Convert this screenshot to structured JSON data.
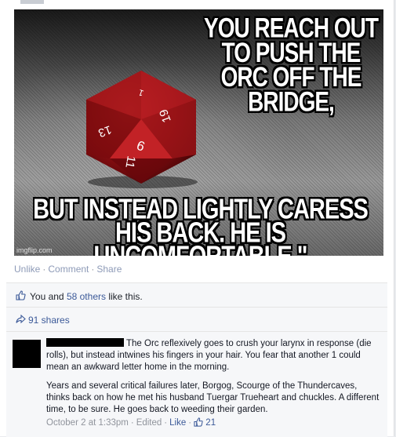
{
  "meme": {
    "top_caption": "You reach out to push the orc off the bridge,",
    "bottom_caption": "But instead lightly caress his back. He is uncomfortable.\"",
    "watermark": "imgflip.com"
  },
  "post_actions": {
    "unlike": "Unlike",
    "comment": "Comment",
    "share": "Share"
  },
  "likes": {
    "prefix": "You and",
    "others": "58 others",
    "suffix": "like this."
  },
  "shares": {
    "label": "91 shares"
  },
  "comment": {
    "line1_text": "The Orc reflexively goes to crush your larynx in response (die rolls), but instead intwines his fingers in your hair. You fear that another 1 could mean an awkward letter home in the morning.",
    "paragraph2": "Years and several critical failures later, Borgog, Scourge of the Thundercaves, thinks back on how he met his husband Tuergar Trueheart and chuckles. A different time, to be sure. He goes back to weeding their garden.",
    "timestamp": "October 2 at 1:33pm",
    "edited": "Edited",
    "like_link": "Like",
    "like_count": "21"
  },
  "colors": {
    "link": "#3b5998",
    "muted": "#90949c",
    "die_red": "#8e0f12"
  }
}
